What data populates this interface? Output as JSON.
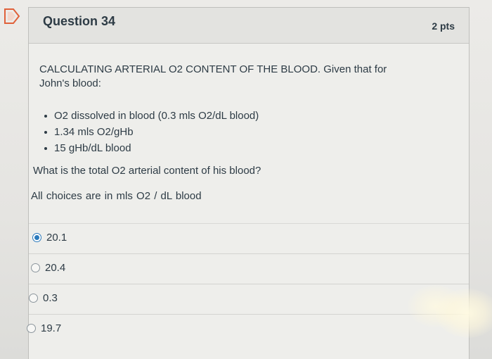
{
  "question": {
    "title": "Question 34",
    "points": "2 pts",
    "intro_line1": "CALCULATING ARTERIAL O2 CONTENT OF THE BLOOD.  Given that for",
    "intro_line2": "John's blood:",
    "givens": [
      "O2 dissolved in blood (0.3 mls O2/dL blood)",
      "1.34 mls O2/gHb",
      "15 gHb/dL blood"
    ],
    "prompt": "What is the total O2 arterial content of his blood?",
    "units_note": "All choices are in   mls O2 / dL blood"
  },
  "answers": [
    {
      "label": "20.1",
      "selected": true
    },
    {
      "label": "20.4",
      "selected": false
    },
    {
      "label": "0.3",
      "selected": false
    },
    {
      "label": "19.7",
      "selected": false
    }
  ],
  "icons": {
    "flag": "flag-icon"
  },
  "colors": {
    "accent": "#2b7abc",
    "text": "#2d3b45",
    "flag": "#e0613a"
  }
}
